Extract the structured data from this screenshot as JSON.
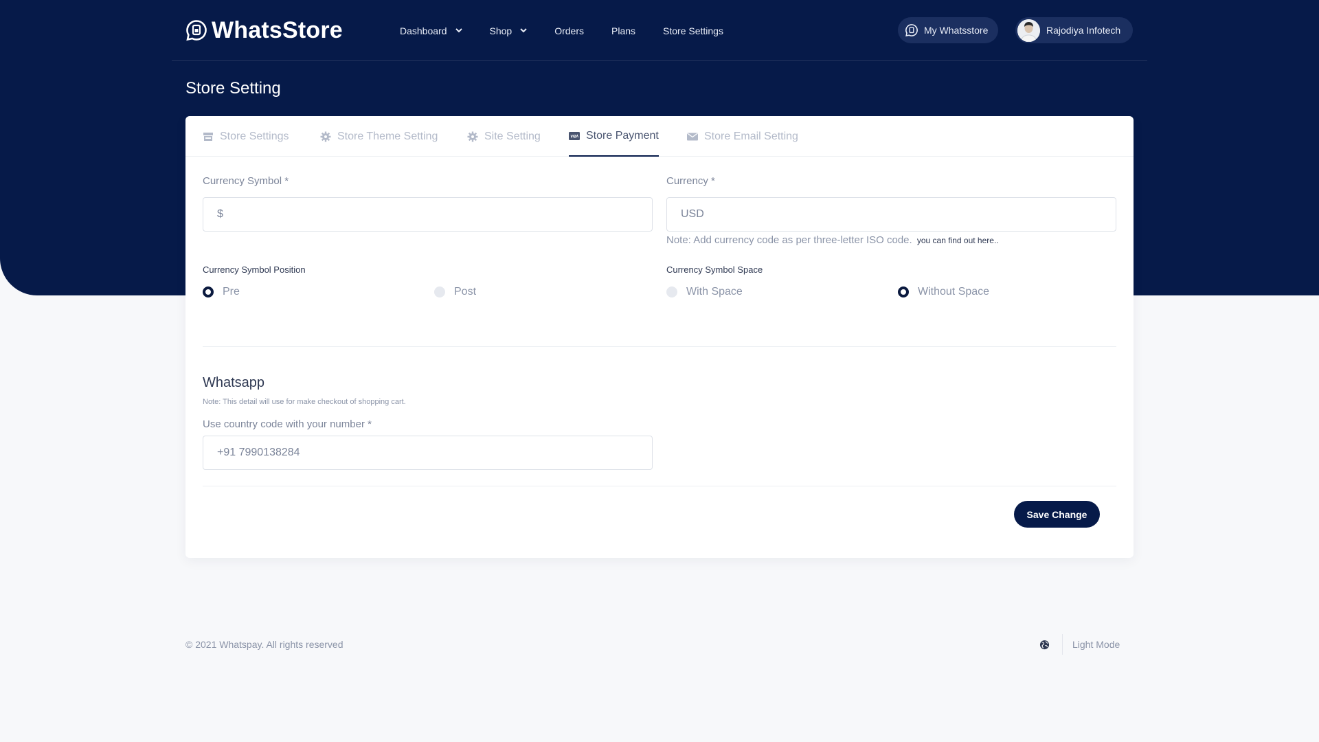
{
  "app": {
    "brand": "WhatsStore"
  },
  "nav": {
    "items": [
      {
        "label": "Dashboard",
        "dropdown": true
      },
      {
        "label": "Shop",
        "dropdown": true
      },
      {
        "label": "Orders",
        "dropdown": false
      },
      {
        "label": "Plans",
        "dropdown": false
      },
      {
        "label": "Store Settings",
        "dropdown": false
      }
    ],
    "my_store_label": "My Whatsstore",
    "user_name": "Rajodiya Infotech"
  },
  "page": {
    "title": "Store Setting"
  },
  "tabs": [
    {
      "label": "Store Settings",
      "icon": "store-icon",
      "active": false
    },
    {
      "label": "Store Theme Setting",
      "icon": "gear-icon",
      "active": false
    },
    {
      "label": "Site Setting",
      "icon": "gear-icon",
      "active": false
    },
    {
      "label": "Store Payment",
      "icon": "visa-card-icon",
      "active": true
    },
    {
      "label": "Store Email Setting",
      "icon": "envelope-icon",
      "active": false
    }
  ],
  "payment": {
    "currency_symbol_label": "Currency Symbol *",
    "currency_symbol_value": "$",
    "currency_label": "Currency *",
    "currency_value": "USD",
    "currency_note": "Note: Add currency code as per three-letter ISO code.",
    "currency_note_link": "you can find out here..",
    "symbol_position_label": "Currency Symbol Position",
    "symbol_position_options": [
      {
        "label": "Pre",
        "selected": true
      },
      {
        "label": "Post",
        "selected": false
      }
    ],
    "symbol_space_label": "Currency Symbol Space",
    "symbol_space_options": [
      {
        "label": "With Space",
        "selected": false
      },
      {
        "label": "Without Space",
        "selected": true
      }
    ]
  },
  "whatsapp": {
    "title": "Whatsapp",
    "note": "Note: This detail will use for make checkout of shopping cart.",
    "number_label": "Use country code with your number *",
    "number_value": "+91 7990138284"
  },
  "actions": {
    "save_label": "Save Change"
  },
  "footer": {
    "copyright": "© 2021 Whatspay. All rights reserved",
    "mode_label": "Light Mode"
  },
  "colors": {
    "primary": "#061a49",
    "page_bg": "#f7f8fa",
    "card_bg": "#ffffff",
    "muted_text": "#8a93a7"
  }
}
